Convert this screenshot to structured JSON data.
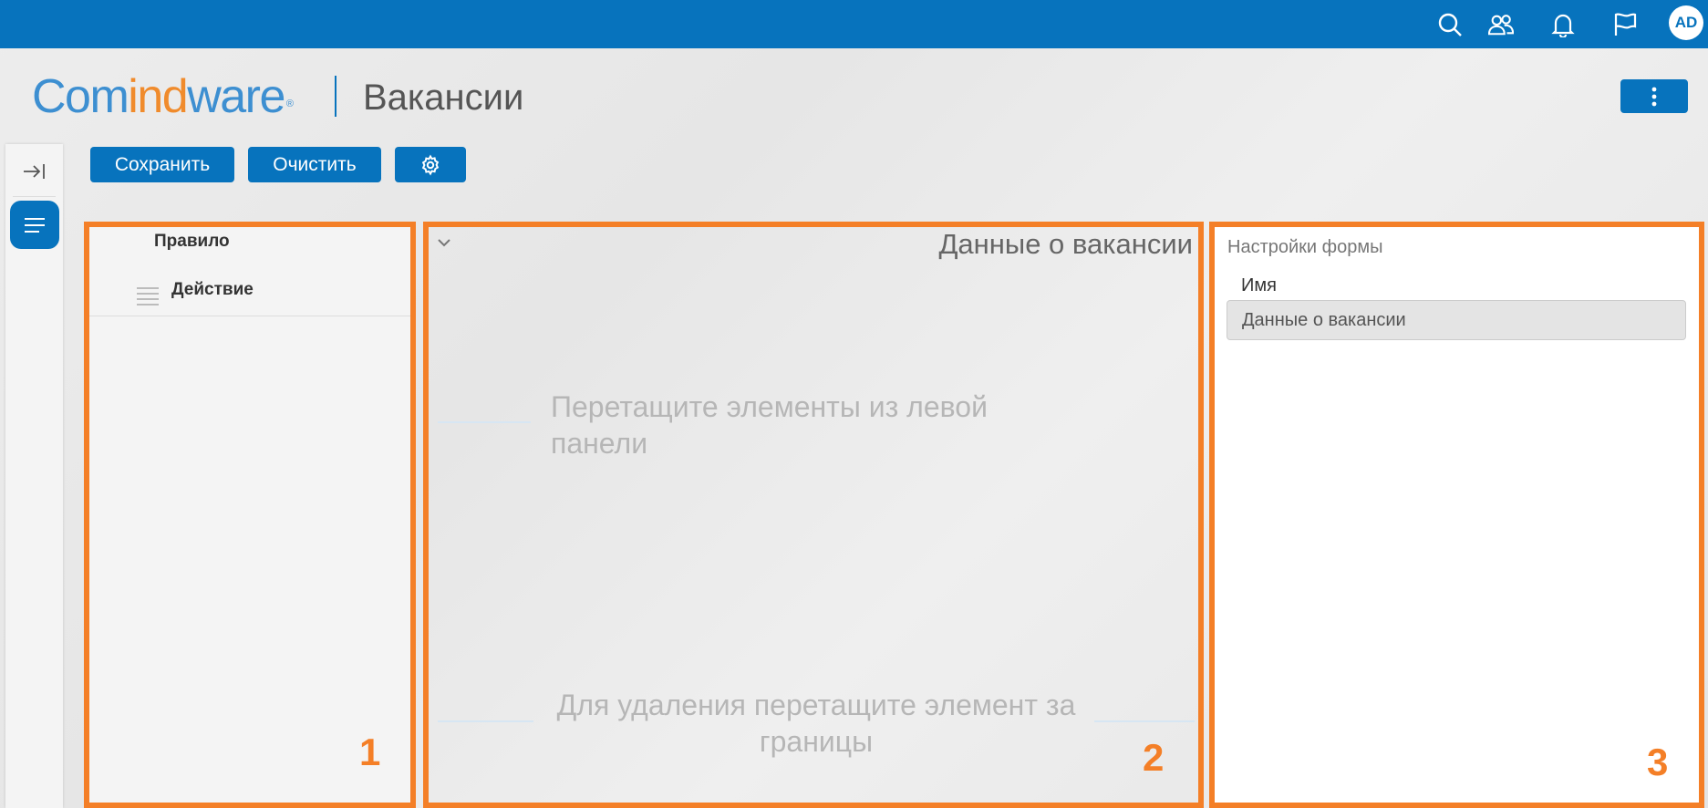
{
  "topbar": {
    "avatar_initials": "AD",
    "icons": [
      "search-icon",
      "users-icon",
      "bell-icon",
      "flag-icon"
    ],
    "color": "#0773bd"
  },
  "header": {
    "logo_part1": "Com",
    "logo_part2": "ind",
    "logo_part3": "ware",
    "logo_mark": "®",
    "page_title": "Вакансии"
  },
  "toolbar": {
    "save_label": "Сохранить",
    "clear_label": "Очистить",
    "settings_icon": "gear-icon"
  },
  "left_panel": {
    "number": "1",
    "items": [
      {
        "label": "Правило"
      },
      {
        "label": "Действие"
      }
    ]
  },
  "center_panel": {
    "number": "2",
    "form_heading": "Данные о вакансии",
    "hint_drag_from_left": "Перетащите элементы из левой панели",
    "hint_delete": "Для удаления перетащите элемент за границы"
  },
  "right_panel": {
    "number": "3",
    "title": "Настройки формы",
    "name_label": "Имя",
    "name_value": "Данные о вакансии"
  },
  "colors": {
    "accent": "#0773bd",
    "highlight": "#f47f27",
    "logo_blue": "#3d8fd1",
    "logo_orange": "#f08b2c"
  }
}
